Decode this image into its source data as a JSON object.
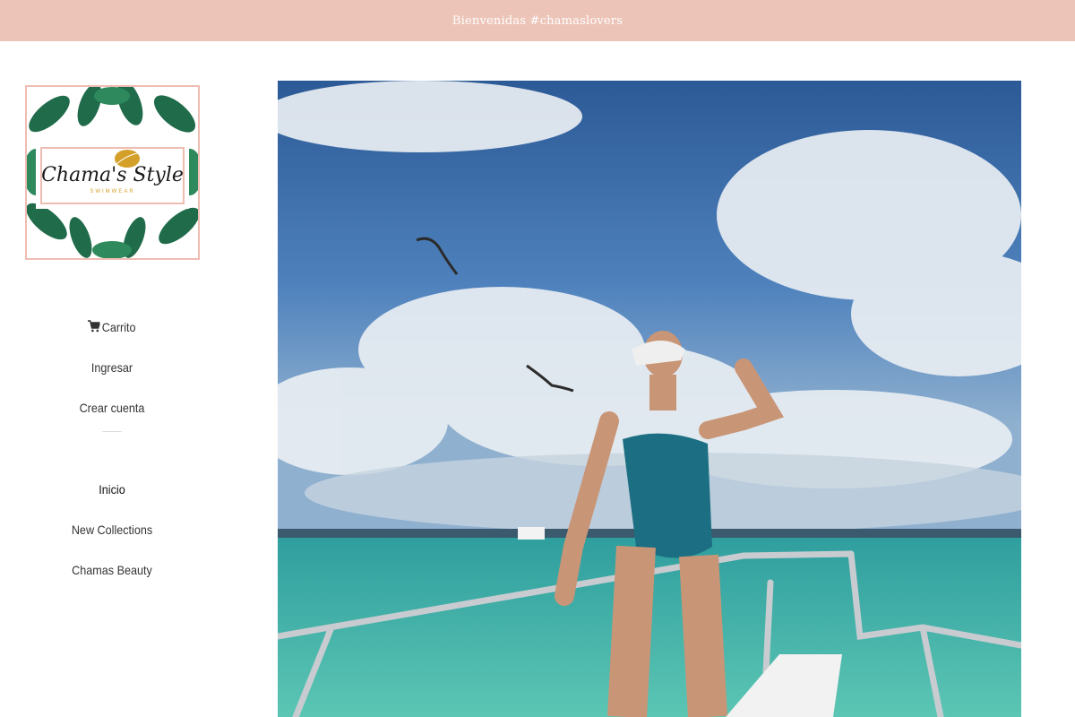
{
  "announcement": {
    "text": "Bienvenidas #chamaslovers"
  },
  "logo": {
    "line1": "Chama's Style",
    "line2": "SWIMWEAR"
  },
  "nav": {
    "cart": "Carrito",
    "login": "Ingresar",
    "register": "Crear cuenta",
    "home": "Inicio",
    "collections": "New Collections",
    "beauty": "Chamas Beauty"
  },
  "icons": {
    "cart": "cart-icon",
    "hero": "hero-image"
  },
  "colors": {
    "announcement_bg": "#ecc4b8",
    "logo_border": "#efbcb2",
    "leaf": "#1f6b4a",
    "accent_gold": "#d4a02a"
  }
}
